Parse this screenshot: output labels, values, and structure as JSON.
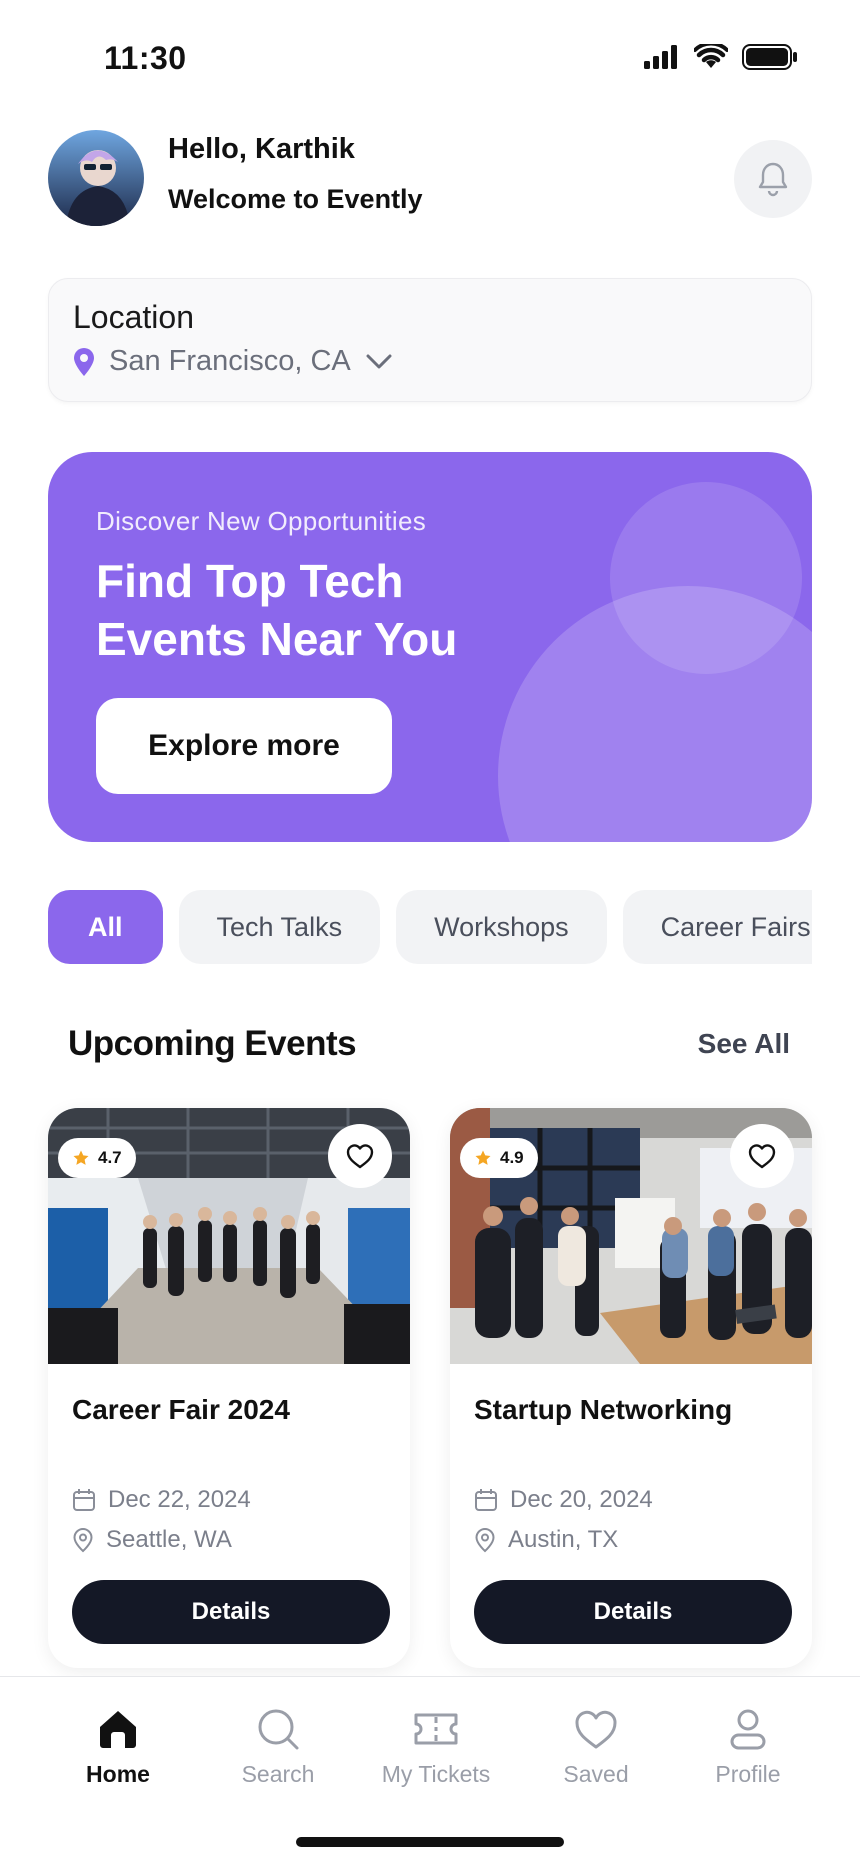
{
  "status_bar": {
    "time": "11:30"
  },
  "header": {
    "greeting": "Hello, Karthik",
    "subtitle": "Welcome to Evently"
  },
  "location": {
    "label": "Location",
    "value": "San Francisco, CA"
  },
  "banner": {
    "eyebrow": "Discover New Opportunities",
    "title": "Find Top Tech Events Near You",
    "cta": "Explore more"
  },
  "categories": [
    "All",
    "Tech Talks",
    "Workshops",
    "Career Fairs"
  ],
  "upcoming": {
    "title": "Upcoming Events",
    "see_all": "See All",
    "events": [
      {
        "rating": "4.7",
        "title": "Career Fair 2024",
        "date": "Dec 22, 2024",
        "location": "Seattle, WA",
        "cta": "Details"
      },
      {
        "rating": "4.9",
        "title": "Startup Networking",
        "date": "Dec 20, 2024",
        "location": "Austin, TX",
        "cta": "Details"
      }
    ]
  },
  "nav": [
    {
      "label": "Home",
      "icon": "home-icon",
      "active": true
    },
    {
      "label": "Search",
      "icon": "search-icon",
      "active": false
    },
    {
      "label": "My Tickets",
      "icon": "ticket-icon",
      "active": false
    },
    {
      "label": "Saved",
      "icon": "heart-icon",
      "active": false
    },
    {
      "label": "Profile",
      "icon": "user-icon",
      "active": false
    }
  ],
  "colors": {
    "accent": "#8b67ec",
    "dark_button": "#141826",
    "muted_text": "#7b7f8b"
  }
}
